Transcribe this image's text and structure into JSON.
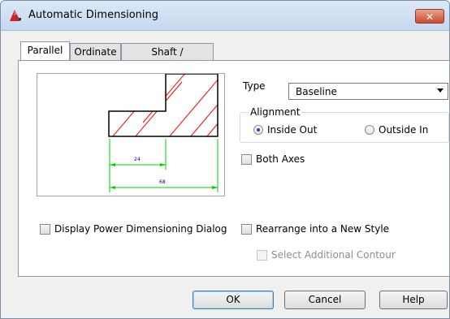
{
  "window": {
    "title": "Automatic Dimensioning",
    "close_glyph": "✕"
  },
  "tabs": [
    {
      "label": "Parallel"
    },
    {
      "label": "Ordinate"
    },
    {
      "label": "Shaft / Symmetric"
    }
  ],
  "preview": {
    "dim_small": "24",
    "dim_large": "68",
    "dim_color": "#00cc00",
    "hatch_color": "#ff0000"
  },
  "type": {
    "label": "Type",
    "selected": "Baseline"
  },
  "alignment": {
    "title": "Alignment",
    "options": [
      {
        "label": "Inside Out",
        "checked": true
      },
      {
        "label": "Outside In",
        "checked": false
      }
    ]
  },
  "checkboxes": {
    "both_axes": "Both Axes",
    "display_power_dim": "Display Power Dimensioning Dialog",
    "rearrange": "Rearrange into a New Style",
    "select_contour": "Select Additional Contour"
  },
  "buttons": {
    "ok": "OK",
    "cancel": "Cancel",
    "help": "Help"
  }
}
